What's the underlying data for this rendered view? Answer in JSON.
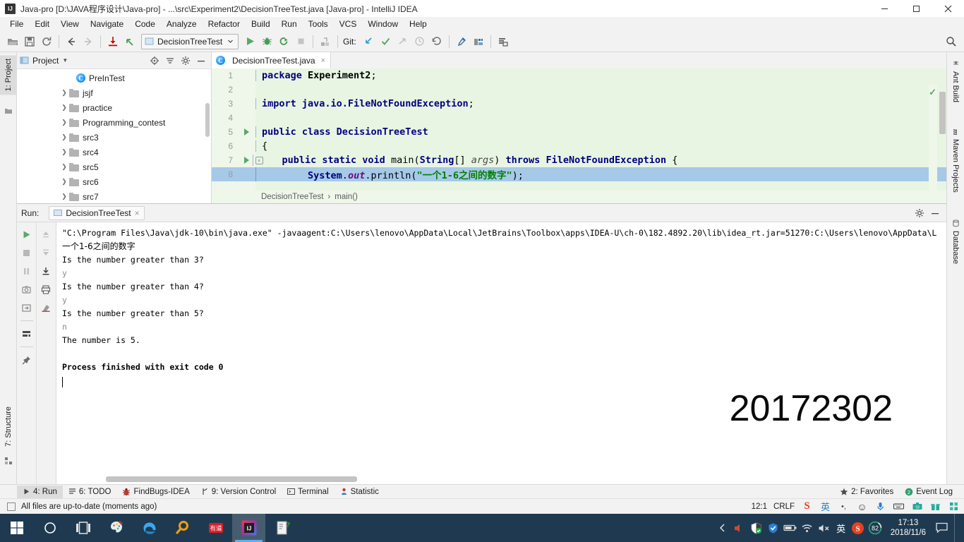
{
  "window": {
    "title": "Java-pro [D:\\JAVA程序设计\\Java-pro] - ...\\src\\Experiment2\\DecisionTreeTest.java [Java-pro] - IntelliJ IDEA",
    "logo_text": "IJ",
    "minimize_label": "Minimize",
    "maximize_label": "Restore",
    "close_label": "Close"
  },
  "menu": {
    "items": [
      {
        "label": "File"
      },
      {
        "label": "Edit"
      },
      {
        "label": "View"
      },
      {
        "label": "Navigate"
      },
      {
        "label": "Code"
      },
      {
        "label": "Analyze"
      },
      {
        "label": "Refactor"
      },
      {
        "label": "Build"
      },
      {
        "label": "Run"
      },
      {
        "label": "Tools"
      },
      {
        "label": "VCS"
      },
      {
        "label": "Window"
      },
      {
        "label": "Help"
      }
    ]
  },
  "toolbar": {
    "open_label": "Open",
    "save_label": "Save All",
    "sync_label": "Synchronize",
    "back_label": "Back",
    "forward_label": "Forward",
    "update_label": "Update Project",
    "commit_label": "Commit",
    "run_config": "DecisionTreeTest",
    "run_label": "Run",
    "debug_label": "Debug",
    "run_coverage_label": "Run with Coverage",
    "stop_label": "Stop",
    "git_label": "Git:",
    "settings_label": "Settings",
    "project_structure_label": "Project Structure",
    "search_label": "Search Everywhere"
  },
  "left_strip": {
    "project_tab": "1: Project",
    "structure_tab": "7: Structure"
  },
  "right_strip": {
    "items": [
      {
        "label": "Ant Build"
      },
      {
        "label": "Maven Projects"
      },
      {
        "label": "Database"
      }
    ]
  },
  "project_panel": {
    "title": "Project",
    "tree": [
      {
        "label": "PreInTest",
        "type": "class",
        "indent": 2,
        "expandable": false
      },
      {
        "label": "jsjf",
        "type": "folder",
        "indent": 1,
        "expandable": true
      },
      {
        "label": "practice",
        "type": "folder",
        "indent": 1,
        "expandable": true
      },
      {
        "label": "Programming_contest",
        "type": "folder",
        "indent": 1,
        "expandable": true
      },
      {
        "label": "src3",
        "type": "folder",
        "indent": 1,
        "expandable": true
      },
      {
        "label": "src4",
        "type": "folder",
        "indent": 1,
        "expandable": true
      },
      {
        "label": "src5",
        "type": "folder",
        "indent": 1,
        "expandable": true
      },
      {
        "label": "src6",
        "type": "folder",
        "indent": 1,
        "expandable": true
      },
      {
        "label": "src7",
        "type": "folder",
        "indent": 1,
        "expandable": true
      }
    ]
  },
  "editor": {
    "tab_label": "DecisionTreeTest.java",
    "tab_close": "×",
    "breadcrumb": [
      "DecisionTreeTest",
      "main()"
    ],
    "breadcrumb_sep": "›",
    "lines": [
      {
        "n": "1",
        "segs": [
          {
            "t": "package ",
            "c": "kw"
          },
          {
            "t": "Experiment2",
            "c": "pkgname"
          },
          {
            "t": ";",
            "c": "plain"
          }
        ]
      },
      {
        "n": "2",
        "segs": []
      },
      {
        "n": "3",
        "segs": [
          {
            "t": "import ",
            "c": "kw"
          },
          {
            "t": "java.io.FileNotFoundException",
            "c": "cls"
          },
          {
            "t": ";",
            "c": "plain"
          }
        ]
      },
      {
        "n": "4",
        "segs": []
      },
      {
        "n": "5",
        "gutter": "run",
        "segs": [
          {
            "t": "public class ",
            "c": "kw"
          },
          {
            "t": "DecisionTreeTest",
            "c": "cls"
          }
        ]
      },
      {
        "n": "6",
        "segs": [
          {
            "t": "{",
            "c": "plain"
          }
        ]
      },
      {
        "n": "7",
        "gutter": "run-fold",
        "segs": [
          {
            "t": "    public static void ",
            "c": "kw"
          },
          {
            "t": "main",
            "c": "plain"
          },
          {
            "t": "(",
            "c": "plain"
          },
          {
            "t": "String",
            "c": "cls"
          },
          {
            "t": "[] ",
            "c": "plain"
          },
          {
            "t": "args",
            "c": "ital"
          },
          {
            "t": ") ",
            "c": "plain"
          },
          {
            "t": "throws ",
            "c": "kw"
          },
          {
            "t": "FileNotFoundException",
            "c": "cls"
          },
          {
            "t": " {",
            "c": "plain"
          }
        ]
      },
      {
        "n": "8",
        "selected": true,
        "segs": [
          {
            "t": "        System",
            "c": "cls"
          },
          {
            "t": ".",
            "c": "plain"
          },
          {
            "t": "out",
            "c": "field"
          },
          {
            "t": ".println(",
            "c": "plain"
          },
          {
            "t": "\"一个1-6之间的数字\"",
            "c": "str"
          },
          {
            "t": ");",
            "c": "plain"
          }
        ]
      }
    ]
  },
  "run_panel": {
    "head_label": "Run:",
    "tab_label": "DecisionTreeTest",
    "tab_close": "×",
    "settings_label": "Settings",
    "minimize_label": "Hide",
    "buttons": {
      "rerun": "Rerun",
      "stop": "Stop",
      "pause": "Pause Output",
      "dump": "Dump Threads",
      "restore": "Restore Layout",
      "scroll_end": "Scroll to End",
      "print": "Print",
      "clear": "Clear All",
      "up": "Up the Stack Trace",
      "down": "Down the Stack Trace",
      "soft_wrap": "Use Soft Wraps",
      "pin": "Pin Tab"
    },
    "console": [
      {
        "text": "\"C:\\Program Files\\Java\\jdk-10\\bin\\java.exe\" -javaagent:C:\\Users\\lenovo\\AppData\\Local\\JetBrains\\Toolbox\\apps\\IDEA-U\\ch-0\\182.4892.20\\lib\\idea_rt.jar=51270:C:\\Users\\lenovo\\AppData\\L",
        "style": "normal"
      },
      {
        "text": "一个1-6之间的数字",
        "style": "cjk"
      },
      {
        "text": "Is the number greater than 3?",
        "style": "normal"
      },
      {
        "text": "y",
        "style": "dim"
      },
      {
        "text": "Is the number greater than 4?",
        "style": "normal"
      },
      {
        "text": "y",
        "style": "dim"
      },
      {
        "text": "Is the number greater than 5?",
        "style": "normal"
      },
      {
        "text": "n",
        "style": "dim"
      },
      {
        "text": "The number is 5.",
        "style": "normal"
      },
      {
        "text": "",
        "style": "normal"
      },
      {
        "text": "Process finished with exit code 0",
        "style": "bold"
      }
    ],
    "watermark": "20172302"
  },
  "bottom_tabs": {
    "items": [
      {
        "label": "4: Run",
        "icon": "run-icon",
        "active": true
      },
      {
        "label": "6: TODO",
        "icon": "todo-icon",
        "active": false
      },
      {
        "label": "FindBugs-IDEA",
        "icon": "findbugs-icon",
        "active": false
      },
      {
        "label": "9: Version Control",
        "icon": "branch-icon",
        "active": false
      },
      {
        "label": "Terminal",
        "icon": "terminal-icon",
        "active": false
      },
      {
        "label": "Statistic",
        "icon": "statistic-icon",
        "active": false
      }
    ],
    "right": [
      {
        "label": "2: Favorites",
        "icon": "star-icon"
      },
      {
        "label": "Event Log",
        "icon": "event-log-icon"
      }
    ]
  },
  "statusbar": {
    "message": "All files are up-to-date (moments ago)",
    "caret_position": "12:1",
    "line_separator": "CRLF",
    "tray": [
      {
        "name": "sogou-s-icon",
        "glyph": "S",
        "color": "#e8401f"
      },
      {
        "name": "ime-chinese-icon",
        "glyph": "英",
        "color": "#2b7fc9"
      },
      {
        "name": "ime-punct-icon",
        "glyph": "•,",
        "color": "#4d4d4d"
      },
      {
        "name": "smiley-icon",
        "glyph": "☺",
        "color": "#3a3a3a"
      },
      {
        "name": "microphone-icon",
        "glyph": "Ἲ4",
        "color": "#2b7fc9"
      },
      {
        "name": "keyboard-icon",
        "glyph": "⌨",
        "color": "#3a3a3a"
      },
      {
        "name": "toolbox-icon",
        "glyph": "▤",
        "color": "#2aa89a"
      },
      {
        "name": "gift-icon",
        "glyph": "Ἰ1",
        "color": "#2aa89a"
      },
      {
        "name": "menu-grid-icon",
        "glyph": "▦",
        "color": "#2aa89a"
      }
    ]
  },
  "taskbar": {
    "items": [
      {
        "name": "start-button",
        "label": "Start"
      },
      {
        "name": "cortana-search-button",
        "label": "Search"
      },
      {
        "name": "task-view-button",
        "label": "Task View"
      },
      {
        "name": "paint-3d-app",
        "label": "Paint 3D"
      },
      {
        "name": "edge-browser-app",
        "label": "Microsoft Edge"
      },
      {
        "name": "search-app",
        "label": "Everything"
      },
      {
        "name": "youdao-dict-app",
        "label": "有道"
      },
      {
        "name": "intellij-idea-app",
        "label": "IntelliJ IDEA",
        "active": true
      },
      {
        "name": "help-document-app",
        "label": "Help"
      }
    ],
    "tray": [
      {
        "name": "volume-muted-icon"
      },
      {
        "name": "security-shield-icon"
      },
      {
        "name": "antivirus-icon"
      },
      {
        "name": "battery-icon"
      },
      {
        "name": "wifi-icon"
      },
      {
        "name": "speaker-muted-icon"
      },
      {
        "name": "ime-english-icon",
        "glyph": "英"
      },
      {
        "name": "sogou-pinyin-icon",
        "glyph": "S"
      },
      {
        "name": "battery-percent-icon",
        "glyph": "82"
      }
    ],
    "clock_time": "17:13",
    "clock_date": "2018/11/6",
    "action_center_label": "Notifications"
  }
}
